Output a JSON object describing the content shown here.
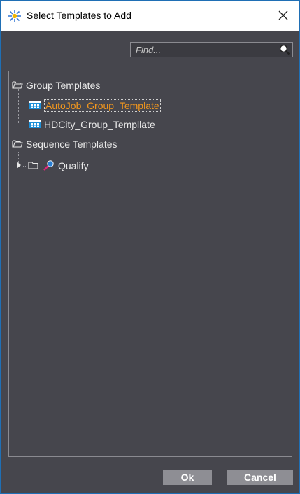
{
  "window": {
    "title": "Select Templates to Add",
    "close_icon": "close-icon"
  },
  "search": {
    "placeholder": "Find...",
    "value": ""
  },
  "tree": {
    "groups": [
      {
        "label": "Group Templates",
        "items": [
          {
            "label": "AutoJob_Group_Template",
            "selected": true
          },
          {
            "label": "HDCity_Group_Templlate",
            "selected": false
          }
        ]
      },
      {
        "label": "Sequence Templates",
        "items": [
          {
            "label": "Qualify",
            "expandable": true
          }
        ]
      }
    ]
  },
  "buttons": {
    "ok": "Ok",
    "cancel": "Cancel"
  },
  "colors": {
    "background": "#46464d",
    "selected_text": "#f0961e",
    "button": "#8e8e94"
  }
}
